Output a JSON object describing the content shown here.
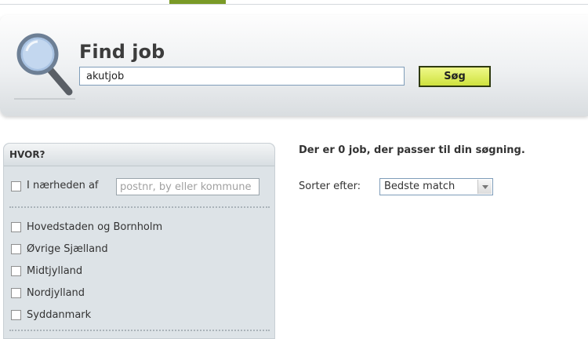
{
  "search": {
    "title": "Find job",
    "query": "akutjob",
    "button_label": "Søg"
  },
  "sidebar": {
    "header": "HVOR?",
    "near_label": "I nærheden af",
    "near_placeholder": "postnr, by eller kommune",
    "regions": [
      {
        "label": "Hovedstaden og Bornholm"
      },
      {
        "label": "Øvrige Sjælland"
      },
      {
        "label": "Midtjylland"
      },
      {
        "label": "Nordjylland"
      },
      {
        "label": "Syddanmark"
      }
    ]
  },
  "results": {
    "summary": "Der er 0 job, der passer til din søgning.",
    "sort_label": "Sorter efter:",
    "sort_selected": "Bedste match"
  },
  "colors": {
    "accent": "#7a9a27",
    "button": "#dcec55",
    "panel": "#dde3e7"
  }
}
